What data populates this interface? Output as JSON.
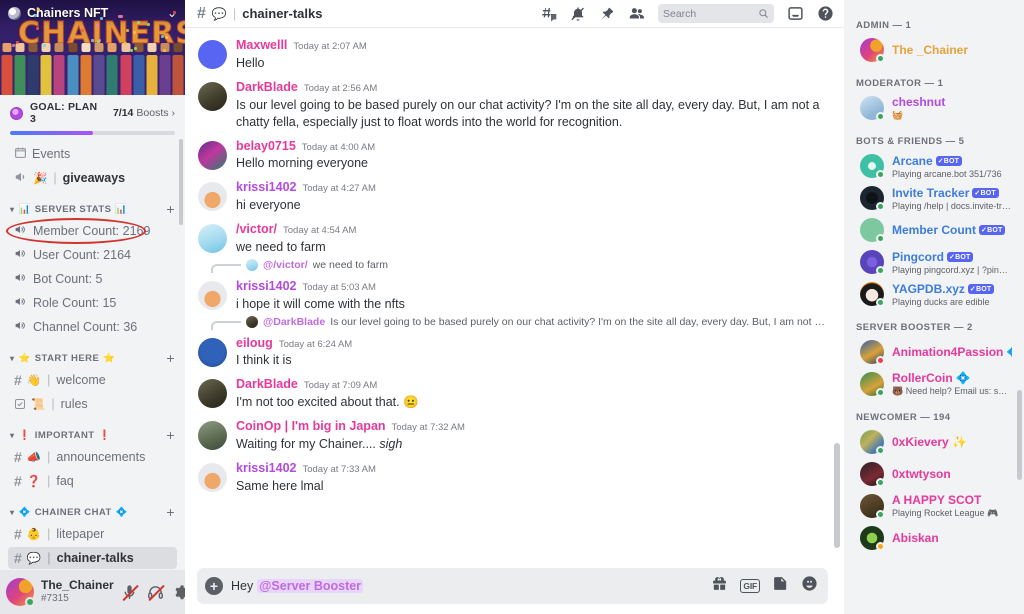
{
  "server": {
    "name": "Chainers NFT",
    "banner_word": "CHAINERS",
    "dropdown_icon": "chevron-down-icon",
    "boost": {
      "label": "GOAL: PLAN 3",
      "count": "7/14",
      "unit": "Boosts",
      "progress_pct": 50,
      "arrow": "chevron-right-icon"
    }
  },
  "sidebar": {
    "top_items": [
      {
        "icon": "calendar-icon",
        "emoji": "",
        "name": "Events",
        "type": "special"
      },
      {
        "icon": "megaphone-icon",
        "emoji": "🎉",
        "name": "giveaways",
        "type": "announcement"
      }
    ],
    "categories": [
      {
        "name": "SERVER STATS",
        "emoji_left": "📊",
        "emoji_right": "📊",
        "add_icon": "plus-icon",
        "channels": [
          {
            "icon": "voice-icon",
            "name": "Member Count: 2169",
            "highlighted": true
          },
          {
            "icon": "voice-icon",
            "name": "User Count: 2164",
            "highlighted": false
          },
          {
            "icon": "voice-icon",
            "name": "Bot Count: 5",
            "highlighted": false
          },
          {
            "icon": "voice-icon",
            "name": "Role Count: 15",
            "highlighted": false
          },
          {
            "icon": "voice-icon",
            "name": "Channel Count: 36",
            "highlighted": false
          }
        ]
      },
      {
        "name": "START HERE",
        "emoji_left": "⭐",
        "emoji_right": "⭐",
        "add_icon": "plus-icon",
        "channels": [
          {
            "icon": "hash-icon",
            "emoji": "👋",
            "name": "welcome"
          },
          {
            "icon": "rules-icon",
            "emoji": "📜",
            "name": "rules"
          }
        ]
      },
      {
        "name": "IMPORTANT",
        "emoji_left": "❗",
        "emoji_right": "❗",
        "add_icon": "plus-icon",
        "channels": [
          {
            "icon": "hash-icon",
            "emoji": "📣",
            "name": "announcements"
          },
          {
            "icon": "hash-icon",
            "emoji": "❓",
            "name": "faq"
          }
        ]
      },
      {
        "name": "CHAINER CHAT",
        "emoji_left": "💠",
        "emoji_right": "💠",
        "add_icon": "plus-icon",
        "channels": [
          {
            "icon": "hash-icon",
            "emoji": "👶",
            "name": "litepaper"
          },
          {
            "icon": "hash-icon",
            "emoji": "💬",
            "name": "chainer-talks",
            "selected": true
          }
        ]
      }
    ]
  },
  "user_panel": {
    "name": "The_Chainer",
    "tag": "#7315",
    "status": "online",
    "controls": [
      {
        "icon": "mic-muted-icon",
        "muted": true
      },
      {
        "icon": "headphones-deafened-icon",
        "muted": true
      },
      {
        "icon": "gear-icon",
        "muted": false
      }
    ]
  },
  "topbar": {
    "hash_icon": "hash-icon",
    "channel_emoji": "💬",
    "channel_name": "chainer-talks",
    "actions": [
      {
        "icon": "threads-icon"
      },
      {
        "icon": "notification-off-icon"
      },
      {
        "icon": "pin-icon"
      },
      {
        "icon": "members-icon"
      }
    ],
    "search": {
      "placeholder": "Search",
      "icon": "search-icon"
    },
    "inbox_icon": "inbox-icon",
    "help_icon": "help-icon"
  },
  "messages": [
    {
      "author": "Maxwelll",
      "color": "#e6399b",
      "timestamp": "Today at 2:07 AM",
      "text": "Hello",
      "avatar": "discord-logo",
      "reply": null
    },
    {
      "author": "DarkBlade",
      "color": "#e6399b",
      "timestamp": "Today at 2:56 AM",
      "text": "Is our level going to be based purely on our chat activity? I'm on the site all day, every day. But, I am not a chatty fella, especially just to float words into the world for recognition.",
      "avatar": "dark-figure",
      "reply": null
    },
    {
      "author": "belay0715",
      "color": "#e6399b",
      "timestamp": "Today at 4:00 AM",
      "text": "Hello morning everyone",
      "avatar": "purple-art",
      "reply": null
    },
    {
      "author": "krissi1402",
      "color": "#b44ae0",
      "timestamp": "Today at 4:27 AM",
      "text": "hi everyone",
      "avatar": "horned-char",
      "reply": null
    },
    {
      "author": "/victor/",
      "color": "#e6399b",
      "timestamp": "Today at 4:54 AM",
      "text": "we need to farm",
      "avatar": "blue-anime",
      "reply": null
    },
    {
      "author": "krissi1402",
      "color": "#b44ae0",
      "timestamp": "Today at 5:03 AM",
      "text": "i hope it will come with the nfts",
      "avatar": "horned-char",
      "reply": {
        "author": "@/victor/",
        "text": "we need to farm",
        "avatar": "blue-anime"
      }
    },
    {
      "author": "eiloug",
      "color": "#e6399b",
      "timestamp": "Today at 6:24 AM",
      "text": "I think it is",
      "avatar": "blue-logo",
      "reply": {
        "author": "@DarkBlade",
        "text": "Is our level going to be based purely on our chat activity? I'm on the site all day, every day. But, I am not a chatt...",
        "avatar": "dark-figure"
      }
    },
    {
      "author": "DarkBlade",
      "color": "#e6399b",
      "timestamp": "Today at 7:09 AM",
      "text": "I'm not too excited about that. 😐",
      "avatar": "dark-figure",
      "reply": null
    },
    {
      "author": "CoinOp | I'm big in Japan",
      "color": "#e6399b",
      "timestamp": "Today at 7:32 AM",
      "text": "Waiting for my Chainer.... ",
      "italic": "sigh",
      "avatar": "outdoor-photo",
      "reply": null
    },
    {
      "author": "krissi1402",
      "color": "#b44ae0",
      "timestamp": "Today at 7:33 AM",
      "text": "Same here lmal",
      "avatar": "horned-char",
      "reply": null
    }
  ],
  "composer": {
    "plus_icon": "plus-circle-icon",
    "text_prefix": "Hey",
    "mention": "@Server Booster",
    "icons": [
      {
        "icon": "gift-icon"
      },
      {
        "icon": "gif-icon",
        "label": "GIF"
      },
      {
        "icon": "sticker-icon"
      },
      {
        "icon": "emoji-icon"
      }
    ]
  },
  "members": {
    "groups": [
      {
        "title": "ADMIN — 1",
        "items": [
          {
            "name": "The _Chainer",
            "color": "#e8a33d",
            "status": "online",
            "sub": "",
            "bot": false,
            "avatar": "orange-purple"
          }
        ]
      },
      {
        "title": "MODERATOR — 1",
        "items": [
          {
            "name": "cheshnut",
            "color": "#b44ae0",
            "status": "online",
            "sub": "🧺",
            "bot": false,
            "avatar": "light-blue"
          }
        ]
      },
      {
        "title": "BOTS & FRIENDS — 5",
        "items": [
          {
            "name": "Arcane",
            "color": "#3c7ddb",
            "status": "online",
            "sub": "Playing arcane.bot 351/736",
            "bot": true,
            "avatar": "teal"
          },
          {
            "name": "Invite Tracker",
            "color": "#3c7ddb",
            "status": "online",
            "sub": "Playing /help | docs.invite-tra...",
            "bot": true,
            "avatar": "black"
          },
          {
            "name": "Member Count",
            "color": "#3c7ddb",
            "status": "online",
            "sub": "",
            "bot": true,
            "avatar": "green"
          },
          {
            "name": "Pingcord",
            "color": "#3c7ddb",
            "status": "online",
            "sub": "Playing pingcord.xyz | ?pingco...",
            "bot": true,
            "avatar": "indigo"
          },
          {
            "name": "YAGPDB.xyz",
            "color": "#3c7ddb",
            "status": "online",
            "sub": "Playing ducks are edible",
            "bot": true,
            "avatar": "orange"
          }
        ]
      },
      {
        "title": "SERVER BOOSTER — 2",
        "items": [
          {
            "name": "Animation4Passion",
            "color": "#e6399b",
            "status": "dnd",
            "sub": "",
            "bot": false,
            "badge": "💠",
            "avatar": "blue-char"
          },
          {
            "name": "RollerCoin",
            "color": "#e6399b",
            "status": "online",
            "sub": "🐻 Need help? Email us: supp...",
            "bot": false,
            "badge": "💠",
            "avatar": "green-char"
          }
        ]
      },
      {
        "title": "NEWCOMER — 194",
        "items": [
          {
            "name": "0xKievery ✨",
            "color": "#e6399b",
            "status": "online",
            "sub": "",
            "bot": false,
            "avatar": "mosaic"
          },
          {
            "name": "0xtwtyson",
            "color": "#e6399b",
            "status": "online",
            "sub": "",
            "bot": false,
            "avatar": "dark-red"
          },
          {
            "name": "A HAPPY SCOT",
            "color": "#e6399b",
            "status": "online",
            "sub": "Playing Rocket League 🎮",
            "bot": false,
            "avatar": "brown"
          },
          {
            "name": "Abiskan",
            "color": "#e6399b",
            "status": "idle",
            "sub": "",
            "bot": false,
            "avatar": "dark-green"
          }
        ]
      }
    ]
  },
  "colors": {
    "accent": "#5865f2",
    "boost_pink": "#ff73fa",
    "online": "#3ba55d",
    "idle": "#faa61a",
    "dnd": "#ed4245",
    "highlight_ellipse": "#d0342c"
  }
}
